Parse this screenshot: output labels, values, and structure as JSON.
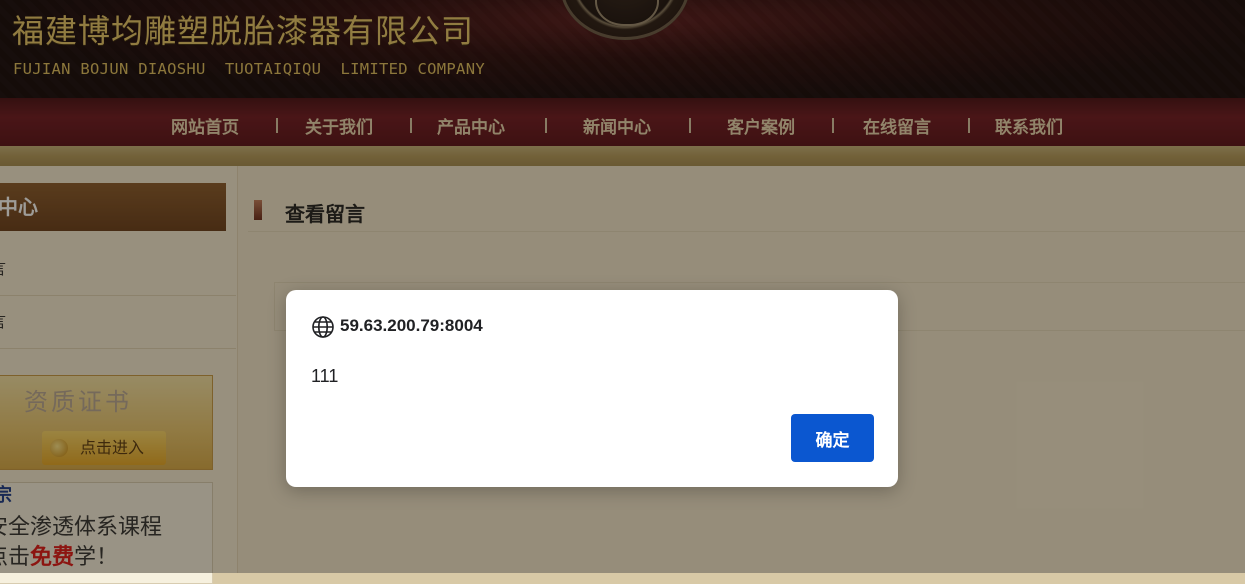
{
  "header": {
    "company_cn": "福建博均雕塑脱胎漆器有限公司",
    "company_en": "FUJIAN BOJUN DIAOSHU  TUOTAIQIQU  LIMITED COMPANY"
  },
  "nav": {
    "items": [
      "网站首页",
      "关于我们",
      "产品中心",
      "新闻中心",
      "客户案例",
      "在线留言",
      "联系我们"
    ]
  },
  "sidebar": {
    "title": "中心",
    "items": [
      "言",
      "言"
    ],
    "cert": {
      "title": "资质证书",
      "button": "点击进入"
    },
    "promo": {
      "heading": "宗",
      "line1": "安全渗透体系课程",
      "line2_prefix": "点击",
      "line2_highlight": "免费",
      "line2_suffix": "学！"
    }
  },
  "main": {
    "title": "查看留言"
  },
  "dialog": {
    "origin": "59.63.200.79:8004",
    "message": "111",
    "ok_label": "确定"
  },
  "colors": {
    "header_bg": "#1a0a0c",
    "nav_bg": "#6e1822",
    "gold_text": "#e8c86a",
    "dialog_button": "#0b57d0"
  }
}
